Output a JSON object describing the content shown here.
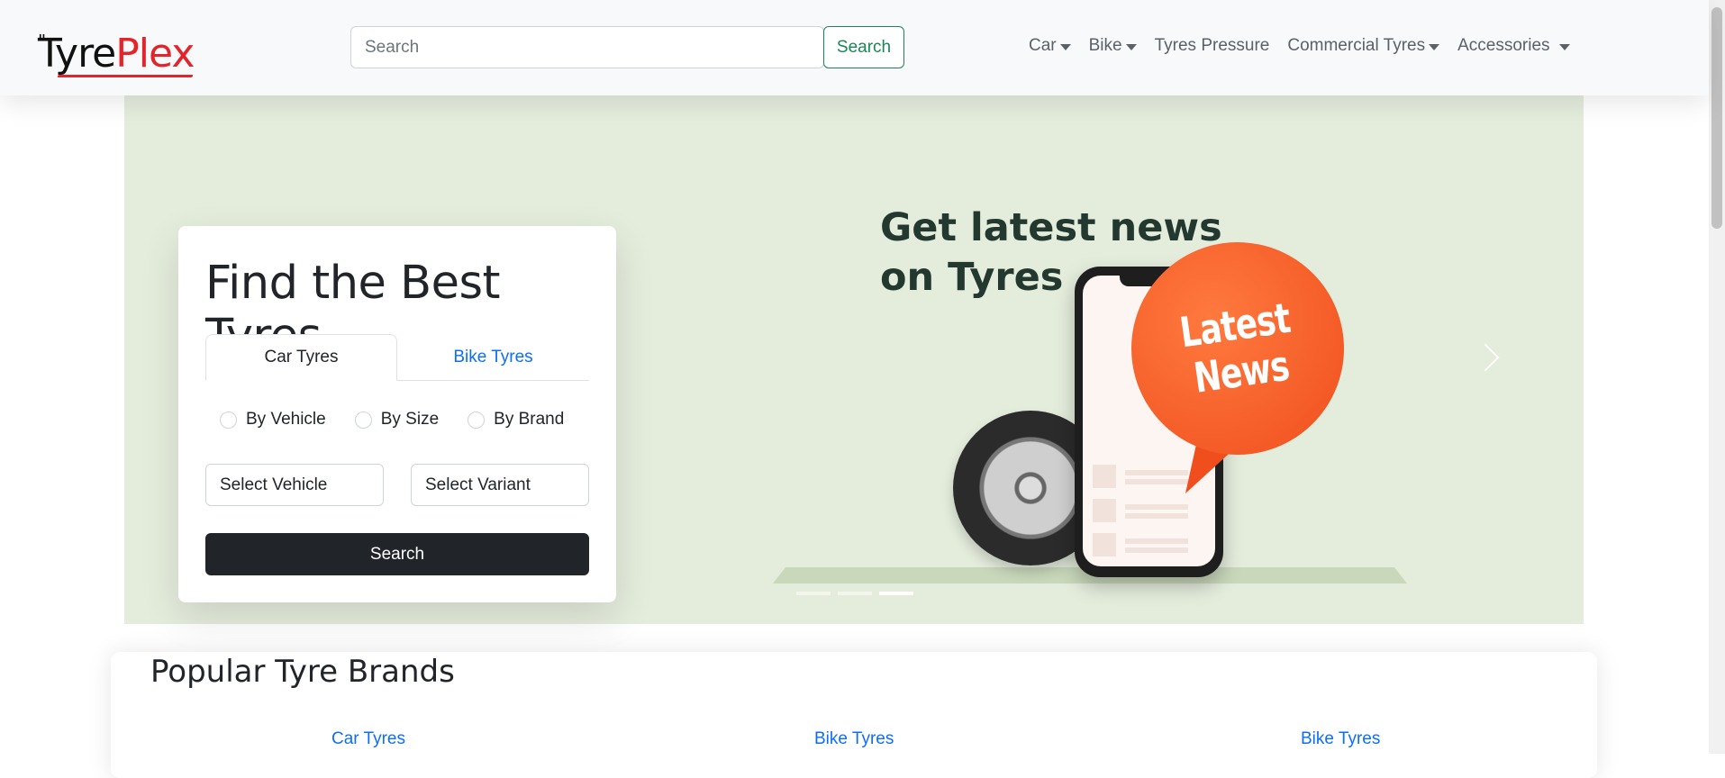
{
  "header": {
    "logo_left": "Tyre",
    "logo_right": "Plex",
    "search_placeholder": "Search",
    "search_button": "Search",
    "menu": [
      {
        "label": "Car",
        "dropdown": true
      },
      {
        "label": "Bike",
        "dropdown": true
      },
      {
        "label": "Tyres Pressure",
        "dropdown": false
      },
      {
        "label": "Commercial Tyres",
        "dropdown": true
      },
      {
        "label": "Accessories",
        "dropdown": true
      }
    ]
  },
  "hero": {
    "heading_line1": "Get latest news",
    "heading_line2": "on Tyres",
    "bubble_line1": "Latest",
    "bubble_line2": "News",
    "active_slide": 3,
    "slide_count": 3
  },
  "finder": {
    "title": "Find the Best Tyres",
    "tabs": [
      "Car Tyres",
      "Bike Tyres"
    ],
    "active_tab": "Car Tyres",
    "radios": [
      "By Vehicle",
      "By Size",
      "By Brand"
    ],
    "select_vehicle": "Select Vehicle",
    "select_variant": "Select Variant",
    "search_button": "Search"
  },
  "brands": {
    "title": "Popular Tyre Brands",
    "links": [
      "Car Tyres",
      "Bike Tyres",
      "Bike Tyres"
    ]
  },
  "colors": {
    "hero_bg": "#e4ecdc",
    "accent_green": "#198754",
    "link_blue": "#0d6efd",
    "logo_red": "#e3242b",
    "bubble_orange": "#f04e1d"
  }
}
